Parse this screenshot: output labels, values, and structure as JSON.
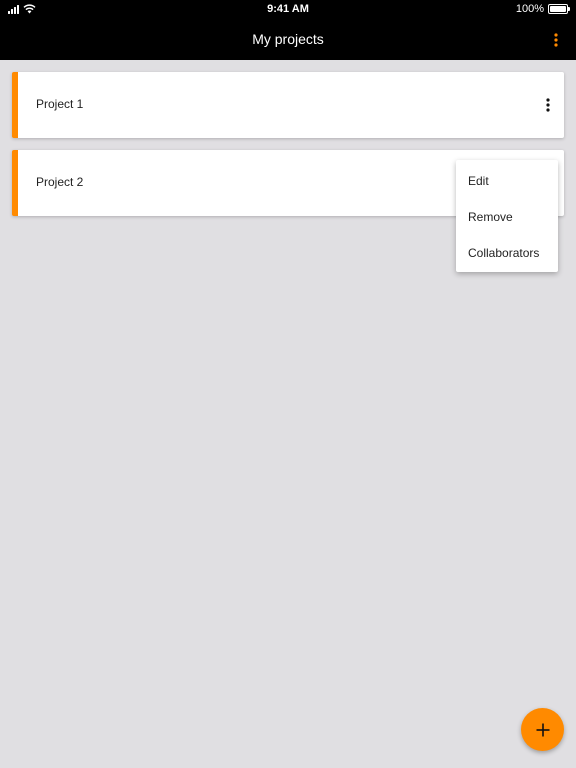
{
  "status_bar": {
    "time": "9:41 AM",
    "battery_text": "100%",
    "battery_level": 1.0,
    "signal_icon": "cellular-signal-icon",
    "wifi_icon": "wifi-icon",
    "battery_icon": "battery-icon"
  },
  "app_bar": {
    "title": "My projects",
    "more_icon": "vertical-dots-icon"
  },
  "projects": [
    {
      "title": "Project 1"
    },
    {
      "title": "Project 2"
    }
  ],
  "context_menu": {
    "items": [
      "Edit",
      "Remove",
      "Collaborators"
    ]
  },
  "fab": {
    "icon": "plus-icon"
  },
  "colors": {
    "accent": "#ff8a00",
    "app_bar": "#000000",
    "background": "#e0dfe2",
    "card": "#ffffff"
  }
}
